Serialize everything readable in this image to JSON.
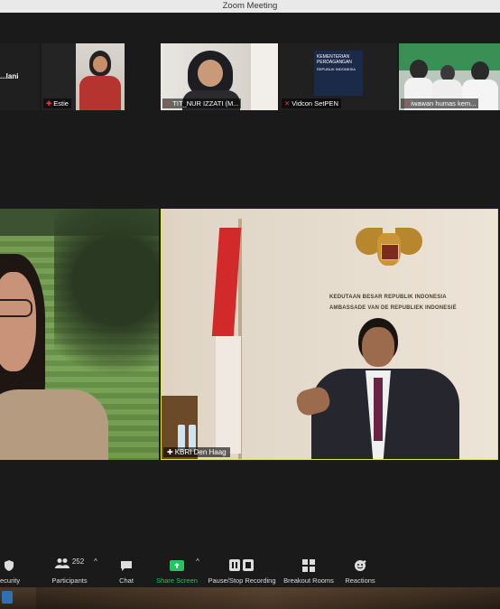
{
  "window": {
    "title": "Zoom Meeting"
  },
  "gallery": [
    {
      "name": "...lani"
    },
    {
      "name": "Estie"
    },
    {
      "name": "TIT_NUR IZZATI (M..."
    },
    {
      "name": "Vidcon SetPEN"
    },
    {
      "name": "iwawan humas kem..."
    }
  ],
  "gallery_logo_text": {
    "line1": "KEMENTERIAN",
    "line2": "PERDAGANGAN",
    "line3": "REPUBLIK INDONESIA"
  },
  "main_videos": [
    {
      "name": ""
    },
    {
      "name": "KBRI Den Haag"
    }
  ],
  "embassy_sign": {
    "line1": "KEDUTAAN BESAR REPUBLIK INDONESIA",
    "line2": "AMBASSADE VAN DE REPUBLIEK INDONESIË"
  },
  "toolbar": {
    "security": "ecurity",
    "participants": "Participants",
    "participant_count": "252",
    "chat": "Chat",
    "share_screen": "Share Screen",
    "recording": "Pause/Stop Recording",
    "breakout": "Breakout Rooms",
    "reactions": "Reactions"
  },
  "colors": {
    "share_green": "#22c55e",
    "active_speaker": "#e6e34a"
  }
}
